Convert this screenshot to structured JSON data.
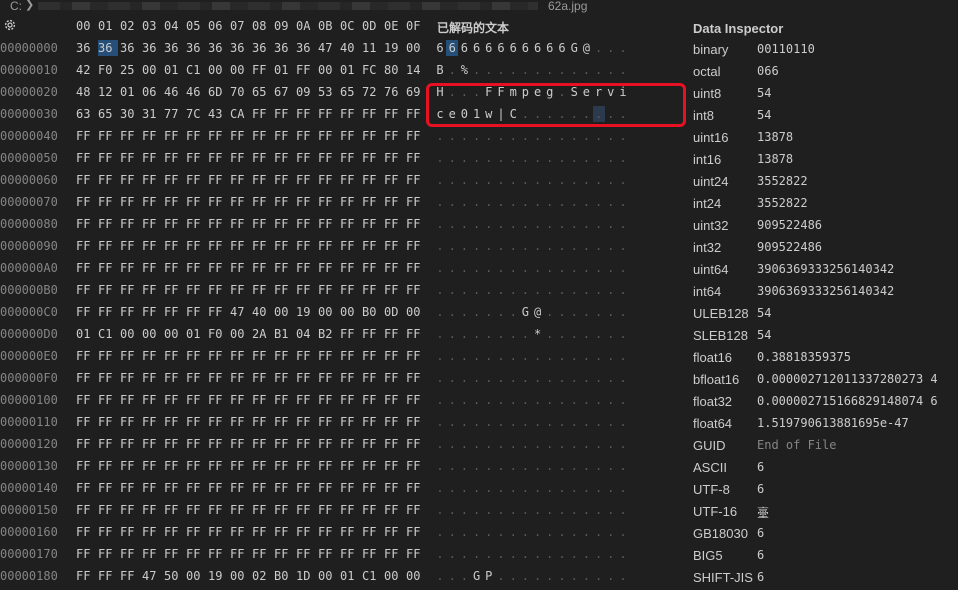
{
  "topbar": {
    "crumb_start": "C:",
    "chevron": "❯",
    "filename": "62a.jpg"
  },
  "hex_header": {
    "columns": [
      "00",
      "01",
      "02",
      "03",
      "04",
      "05",
      "06",
      "07",
      "08",
      "09",
      "0A",
      "0B",
      "0C",
      "0D",
      "0E",
      "0F"
    ],
    "decoded_title": "已解码的文本"
  },
  "rows": [
    {
      "offset": "00000000",
      "bytes": [
        "36",
        "36",
        "36",
        "36",
        "36",
        "36",
        "36",
        "36",
        "36",
        "36",
        "36",
        "47",
        "40",
        "11",
        "19",
        "00"
      ],
      "decoded": [
        "6",
        "6",
        "6",
        "6",
        "6",
        "6",
        "6",
        "6",
        "6",
        "6",
        "6",
        "G",
        "@",
        ".",
        ".",
        "."
      ]
    },
    {
      "offset": "00000010",
      "bytes": [
        "42",
        "F0",
        "25",
        "00",
        "01",
        "C1",
        "00",
        "00",
        "FF",
        "01",
        "FF",
        "00",
        "01",
        "FC",
        "80",
        "14"
      ],
      "decoded": [
        "B",
        ".",
        "%",
        ".",
        ".",
        ".",
        ".",
        ".",
        ".",
        ".",
        ".",
        ".",
        ".",
        ".",
        ".",
        "."
      ]
    },
    {
      "offset": "00000020",
      "bytes": [
        "48",
        "12",
        "01",
        "06",
        "46",
        "46",
        "6D",
        "70",
        "65",
        "67",
        "09",
        "53",
        "65",
        "72",
        "76",
        "69"
      ],
      "decoded": [
        "H",
        ".",
        ".",
        ".",
        "F",
        "F",
        "m",
        "p",
        "e",
        "g",
        ".",
        "S",
        "e",
        "r",
        "v",
        "i"
      ]
    },
    {
      "offset": "00000030",
      "bytes": [
        "63",
        "65",
        "30",
        "31",
        "77",
        "7C",
        "43",
        "CA",
        "FF",
        "FF",
        "FF",
        "FF",
        "FF",
        "FF",
        "FF",
        "FF"
      ],
      "decoded": [
        "c",
        "e",
        "0",
        "1",
        "w",
        "|",
        "C",
        ".",
        ".",
        ".",
        ".",
        ".",
        ".",
        ".",
        ".",
        "."
      ]
    },
    {
      "offset": "00000040",
      "bytes": [
        "FF",
        "FF",
        "FF",
        "FF",
        "FF",
        "FF",
        "FF",
        "FF",
        "FF",
        "FF",
        "FF",
        "FF",
        "FF",
        "FF",
        "FF",
        "FF"
      ],
      "decoded": [
        ".",
        ".",
        ".",
        ".",
        ".",
        ".",
        ".",
        ".",
        ".",
        ".",
        ".",
        ".",
        ".",
        ".",
        ".",
        "."
      ]
    },
    {
      "offset": "00000050",
      "bytes": [
        "FF",
        "FF",
        "FF",
        "FF",
        "FF",
        "FF",
        "FF",
        "FF",
        "FF",
        "FF",
        "FF",
        "FF",
        "FF",
        "FF",
        "FF",
        "FF"
      ],
      "decoded": [
        ".",
        ".",
        ".",
        ".",
        ".",
        ".",
        ".",
        ".",
        ".",
        ".",
        ".",
        ".",
        ".",
        ".",
        ".",
        "."
      ]
    },
    {
      "offset": "00000060",
      "bytes": [
        "FF",
        "FF",
        "FF",
        "FF",
        "FF",
        "FF",
        "FF",
        "FF",
        "FF",
        "FF",
        "FF",
        "FF",
        "FF",
        "FF",
        "FF",
        "FF"
      ],
      "decoded": [
        ".",
        ".",
        ".",
        ".",
        ".",
        ".",
        ".",
        ".",
        ".",
        ".",
        ".",
        ".",
        ".",
        ".",
        ".",
        "."
      ]
    },
    {
      "offset": "00000070",
      "bytes": [
        "FF",
        "FF",
        "FF",
        "FF",
        "FF",
        "FF",
        "FF",
        "FF",
        "FF",
        "FF",
        "FF",
        "FF",
        "FF",
        "FF",
        "FF",
        "FF"
      ],
      "decoded": [
        ".",
        ".",
        ".",
        ".",
        ".",
        ".",
        ".",
        ".",
        ".",
        ".",
        ".",
        ".",
        ".",
        ".",
        ".",
        "."
      ]
    },
    {
      "offset": "00000080",
      "bytes": [
        "FF",
        "FF",
        "FF",
        "FF",
        "FF",
        "FF",
        "FF",
        "FF",
        "FF",
        "FF",
        "FF",
        "FF",
        "FF",
        "FF",
        "FF",
        "FF"
      ],
      "decoded": [
        ".",
        ".",
        ".",
        ".",
        ".",
        ".",
        ".",
        ".",
        ".",
        ".",
        ".",
        ".",
        ".",
        ".",
        ".",
        "."
      ]
    },
    {
      "offset": "00000090",
      "bytes": [
        "FF",
        "FF",
        "FF",
        "FF",
        "FF",
        "FF",
        "FF",
        "FF",
        "FF",
        "FF",
        "FF",
        "FF",
        "FF",
        "FF",
        "FF",
        "FF"
      ],
      "decoded": [
        ".",
        ".",
        ".",
        ".",
        ".",
        ".",
        ".",
        ".",
        ".",
        ".",
        ".",
        ".",
        ".",
        ".",
        ".",
        "."
      ]
    },
    {
      "offset": "000000A0",
      "bytes": [
        "FF",
        "FF",
        "FF",
        "FF",
        "FF",
        "FF",
        "FF",
        "FF",
        "FF",
        "FF",
        "FF",
        "FF",
        "FF",
        "FF",
        "FF",
        "FF"
      ],
      "decoded": [
        ".",
        ".",
        ".",
        ".",
        ".",
        ".",
        ".",
        ".",
        ".",
        ".",
        ".",
        ".",
        ".",
        ".",
        ".",
        "."
      ]
    },
    {
      "offset": "000000B0",
      "bytes": [
        "FF",
        "FF",
        "FF",
        "FF",
        "FF",
        "FF",
        "FF",
        "FF",
        "FF",
        "FF",
        "FF",
        "FF",
        "FF",
        "FF",
        "FF",
        "FF"
      ],
      "decoded": [
        ".",
        ".",
        ".",
        ".",
        ".",
        ".",
        ".",
        ".",
        ".",
        ".",
        ".",
        ".",
        ".",
        ".",
        ".",
        "."
      ]
    },
    {
      "offset": "000000C0",
      "bytes": [
        "FF",
        "FF",
        "FF",
        "FF",
        "FF",
        "FF",
        "FF",
        "47",
        "40",
        "00",
        "19",
        "00",
        "00",
        "B0",
        "0D",
        "00"
      ],
      "decoded": [
        ".",
        ".",
        ".",
        ".",
        ".",
        ".",
        ".",
        "G",
        "@",
        ".",
        ".",
        ".",
        ".",
        ".",
        ".",
        "."
      ]
    },
    {
      "offset": "000000D0",
      "bytes": [
        "01",
        "C1",
        "00",
        "00",
        "00",
        "01",
        "F0",
        "00",
        "2A",
        "B1",
        "04",
        "B2",
        "FF",
        "FF",
        "FF",
        "FF"
      ],
      "decoded": [
        ".",
        ".",
        ".",
        ".",
        ".",
        ".",
        ".",
        ".",
        "*",
        ".",
        ".",
        ".",
        ".",
        ".",
        ".",
        "."
      ]
    },
    {
      "offset": "000000E0",
      "bytes": [
        "FF",
        "FF",
        "FF",
        "FF",
        "FF",
        "FF",
        "FF",
        "FF",
        "FF",
        "FF",
        "FF",
        "FF",
        "FF",
        "FF",
        "FF",
        "FF"
      ],
      "decoded": [
        ".",
        ".",
        ".",
        ".",
        ".",
        ".",
        ".",
        ".",
        ".",
        ".",
        ".",
        ".",
        ".",
        ".",
        ".",
        "."
      ]
    },
    {
      "offset": "000000F0",
      "bytes": [
        "FF",
        "FF",
        "FF",
        "FF",
        "FF",
        "FF",
        "FF",
        "FF",
        "FF",
        "FF",
        "FF",
        "FF",
        "FF",
        "FF",
        "FF",
        "FF"
      ],
      "decoded": [
        ".",
        ".",
        ".",
        ".",
        ".",
        ".",
        ".",
        ".",
        ".",
        ".",
        ".",
        ".",
        ".",
        ".",
        ".",
        "."
      ]
    },
    {
      "offset": "00000100",
      "bytes": [
        "FF",
        "FF",
        "FF",
        "FF",
        "FF",
        "FF",
        "FF",
        "FF",
        "FF",
        "FF",
        "FF",
        "FF",
        "FF",
        "FF",
        "FF",
        "FF"
      ],
      "decoded": [
        ".",
        ".",
        ".",
        ".",
        ".",
        ".",
        ".",
        ".",
        ".",
        ".",
        ".",
        ".",
        ".",
        ".",
        ".",
        "."
      ]
    },
    {
      "offset": "00000110",
      "bytes": [
        "FF",
        "FF",
        "FF",
        "FF",
        "FF",
        "FF",
        "FF",
        "FF",
        "FF",
        "FF",
        "FF",
        "FF",
        "FF",
        "FF",
        "FF",
        "FF"
      ],
      "decoded": [
        ".",
        ".",
        ".",
        ".",
        ".",
        ".",
        ".",
        ".",
        ".",
        ".",
        ".",
        ".",
        ".",
        ".",
        ".",
        "."
      ]
    },
    {
      "offset": "00000120",
      "bytes": [
        "FF",
        "FF",
        "FF",
        "FF",
        "FF",
        "FF",
        "FF",
        "FF",
        "FF",
        "FF",
        "FF",
        "FF",
        "FF",
        "FF",
        "FF",
        "FF"
      ],
      "decoded": [
        ".",
        ".",
        ".",
        ".",
        ".",
        ".",
        ".",
        ".",
        ".",
        ".",
        ".",
        ".",
        ".",
        ".",
        ".",
        "."
      ]
    },
    {
      "offset": "00000130",
      "bytes": [
        "FF",
        "FF",
        "FF",
        "FF",
        "FF",
        "FF",
        "FF",
        "FF",
        "FF",
        "FF",
        "FF",
        "FF",
        "FF",
        "FF",
        "FF",
        "FF"
      ],
      "decoded": [
        ".",
        ".",
        ".",
        ".",
        ".",
        ".",
        ".",
        ".",
        ".",
        ".",
        ".",
        ".",
        ".",
        ".",
        ".",
        "."
      ]
    },
    {
      "offset": "00000140",
      "bytes": [
        "FF",
        "FF",
        "FF",
        "FF",
        "FF",
        "FF",
        "FF",
        "FF",
        "FF",
        "FF",
        "FF",
        "FF",
        "FF",
        "FF",
        "FF",
        "FF"
      ],
      "decoded": [
        ".",
        ".",
        ".",
        ".",
        ".",
        ".",
        ".",
        ".",
        ".",
        ".",
        ".",
        ".",
        ".",
        ".",
        ".",
        "."
      ]
    },
    {
      "offset": "00000150",
      "bytes": [
        "FF",
        "FF",
        "FF",
        "FF",
        "FF",
        "FF",
        "FF",
        "FF",
        "FF",
        "FF",
        "FF",
        "FF",
        "FF",
        "FF",
        "FF",
        "FF"
      ],
      "decoded": [
        ".",
        ".",
        ".",
        ".",
        ".",
        ".",
        ".",
        ".",
        ".",
        ".",
        ".",
        ".",
        ".",
        ".",
        ".",
        "."
      ]
    },
    {
      "offset": "00000160",
      "bytes": [
        "FF",
        "FF",
        "FF",
        "FF",
        "FF",
        "FF",
        "FF",
        "FF",
        "FF",
        "FF",
        "FF",
        "FF",
        "FF",
        "FF",
        "FF",
        "FF"
      ],
      "decoded": [
        ".",
        ".",
        ".",
        ".",
        ".",
        ".",
        ".",
        ".",
        ".",
        ".",
        ".",
        ".",
        ".",
        ".",
        ".",
        "."
      ]
    },
    {
      "offset": "00000170",
      "bytes": [
        "FF",
        "FF",
        "FF",
        "FF",
        "FF",
        "FF",
        "FF",
        "FF",
        "FF",
        "FF",
        "FF",
        "FF",
        "FF",
        "FF",
        "FF",
        "FF"
      ],
      "decoded": [
        ".",
        ".",
        ".",
        ".",
        ".",
        ".",
        ".",
        ".",
        ".",
        ".",
        ".",
        ".",
        ".",
        ".",
        ".",
        "."
      ]
    },
    {
      "offset": "00000180",
      "bytes": [
        "FF",
        "FF",
        "FF",
        "47",
        "50",
        "00",
        "19",
        "00",
        "02",
        "B0",
        "1D",
        "00",
        "01",
        "C1",
        "00",
        "00"
      ],
      "decoded": [
        ".",
        ".",
        ".",
        "G",
        "P",
        ".",
        ".",
        ".",
        ".",
        ".",
        ".",
        ".",
        ".",
        ".",
        ".",
        "."
      ]
    }
  ],
  "selection": {
    "byte_row": 0,
    "byte_col": 1,
    "decoded_secondary": {
      "row": 3,
      "col": 13
    }
  },
  "inspector": {
    "title": "Data Inspector",
    "items": [
      {
        "label": "binary",
        "value": "00110110"
      },
      {
        "label": "octal",
        "value": "066"
      },
      {
        "label": "uint8",
        "value": "54"
      },
      {
        "label": "int8",
        "value": "54"
      },
      {
        "label": "uint16",
        "value": "13878"
      },
      {
        "label": "int16",
        "value": "13878"
      },
      {
        "label": "uint24",
        "value": "3552822"
      },
      {
        "label": "int24",
        "value": "3552822"
      },
      {
        "label": "uint32",
        "value": "909522486"
      },
      {
        "label": "int32",
        "value": "909522486"
      },
      {
        "label": "uint64",
        "value": "3906369333256140342"
      },
      {
        "label": "int64",
        "value": "3906369333256140342"
      },
      {
        "label": "ULEB128",
        "value": "54"
      },
      {
        "label": "SLEB128",
        "value": "54"
      },
      {
        "label": "float16",
        "value": "0.38818359375"
      },
      {
        "label": "bfloat16",
        "value": "0.000002712011337280273 4"
      },
      {
        "label": "float32",
        "value": "0.000002715166829148074 6"
      },
      {
        "label": "float64",
        "value": "1.519790613881695e-47"
      },
      {
        "label": "GUID",
        "value": "End of File",
        "muted": true
      },
      {
        "label": "ASCII",
        "value": "6"
      },
      {
        "label": "UTF-8",
        "value": "6"
      },
      {
        "label": "UTF-16",
        "value": "㙶"
      },
      {
        "label": "GB18030",
        "value": "6"
      },
      {
        "label": "BIG5",
        "value": "6"
      },
      {
        "label": "SHIFT-JIS",
        "value": "6"
      }
    ]
  },
  "colors": {
    "background": "#1f1f1f",
    "text": "#cccccc",
    "offset": "#858585",
    "selection": "#264f78",
    "annotation": "#e81123"
  }
}
